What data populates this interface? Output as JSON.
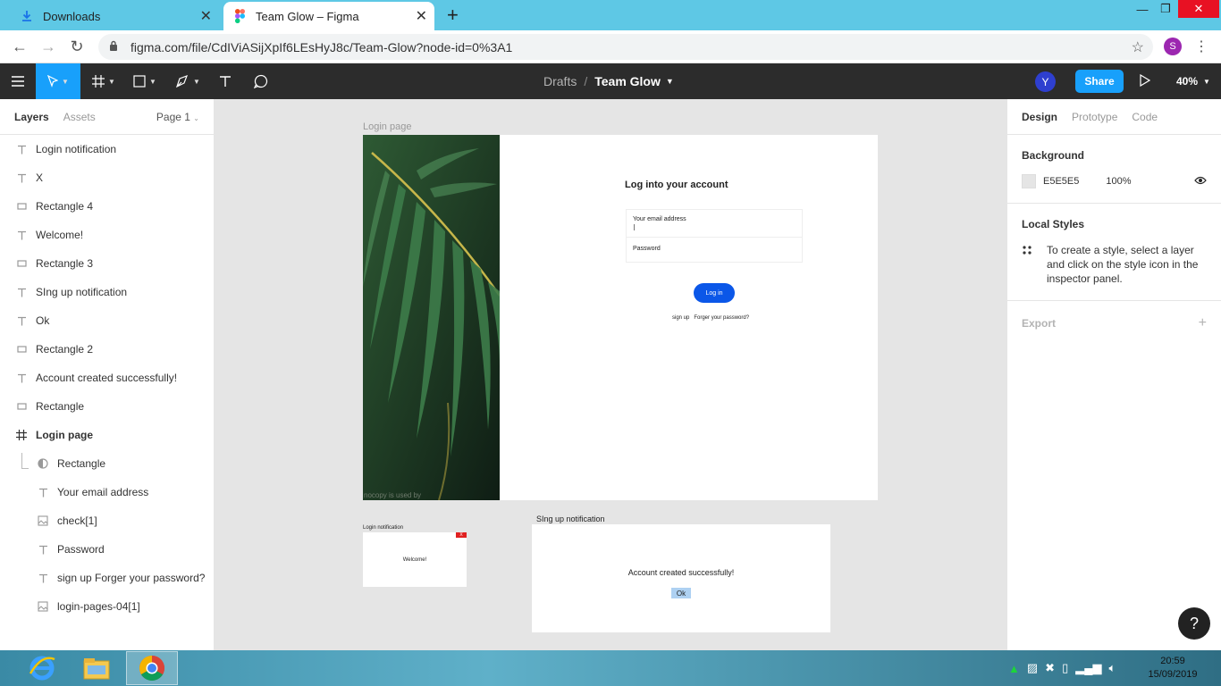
{
  "browser": {
    "tabs": [
      {
        "label": "Downloads",
        "active": false
      },
      {
        "label": "Team Glow – Figma",
        "active": true
      }
    ],
    "url": "figma.com/file/CdIViASijXpIf6LEsHyJ8c/Team-Glow?node-id=0%3A1",
    "profile_initial": "S"
  },
  "toolbar": {
    "breadcrumb_root": "Drafts",
    "breadcrumb_sep": "/",
    "file_name": "Team Glow",
    "user_initial": "Y",
    "share_label": "Share",
    "zoom": "40%"
  },
  "left_panel": {
    "tab_layers": "Layers",
    "tab_assets": "Assets",
    "page": "Page 1",
    "layers": [
      {
        "name": "Login notification",
        "icon": "text"
      },
      {
        "name": "X",
        "icon": "text"
      },
      {
        "name": "Rectangle 4",
        "icon": "rect"
      },
      {
        "name": "Welcome!",
        "icon": "text"
      },
      {
        "name": "Rectangle 3",
        "icon": "rect"
      },
      {
        "name": "SIng up notification",
        "icon": "text"
      },
      {
        "name": "Ok",
        "icon": "text"
      },
      {
        "name": "Rectangle 2",
        "icon": "rect"
      },
      {
        "name": "Account created successfully!",
        "icon": "text"
      },
      {
        "name": "Rectangle",
        "icon": "rect"
      },
      {
        "name": "Login page",
        "icon": "frame"
      },
      {
        "name": "Rectangle",
        "icon": "mask"
      },
      {
        "name": "Your email address",
        "icon": "text"
      },
      {
        "name": "check[1]",
        "icon": "image"
      },
      {
        "name": "Password",
        "icon": "text"
      },
      {
        "name": "sign up Forger your password?",
        "icon": "text"
      },
      {
        "name": "login-pages-04[1]",
        "icon": "image"
      }
    ]
  },
  "right_panel": {
    "tab_design": "Design",
    "tab_prototype": "Prototype",
    "tab_code": "Code",
    "background_title": "Background",
    "background_hex": "E5E5E5",
    "background_opacity": "100%",
    "local_styles_title": "Local Styles",
    "local_styles_hint": "To create a style, select a layer and click on the style icon in the inspector panel.",
    "export_title": "Export",
    "help_label": "?"
  },
  "canvas": {
    "frame_label": "Login page",
    "login_title": "Log into your account",
    "email_label": "Your email address",
    "password_label": "Password",
    "login_button": "Log in",
    "signup_links": "sign up   Forger your password?",
    "image_caption": "nocopy is used by",
    "small_notif_label": "Login notification",
    "small_notif_close": "X",
    "small_notif_text": "Welcome!",
    "big_notif_label": "SIng up notification",
    "big_notif_text": "Account created successfully!",
    "big_notif_ok": "Ok"
  },
  "taskbar": {
    "time": "20:59",
    "date": "15/09/2019"
  },
  "colors": {
    "figma_blue": "#18a0fb",
    "toolbar_bg": "#2c2c2c",
    "canvas_bg": "#e5e5e5",
    "login_button": "#0b57e8",
    "chrome_tabstrip": "#5ec8e5"
  }
}
